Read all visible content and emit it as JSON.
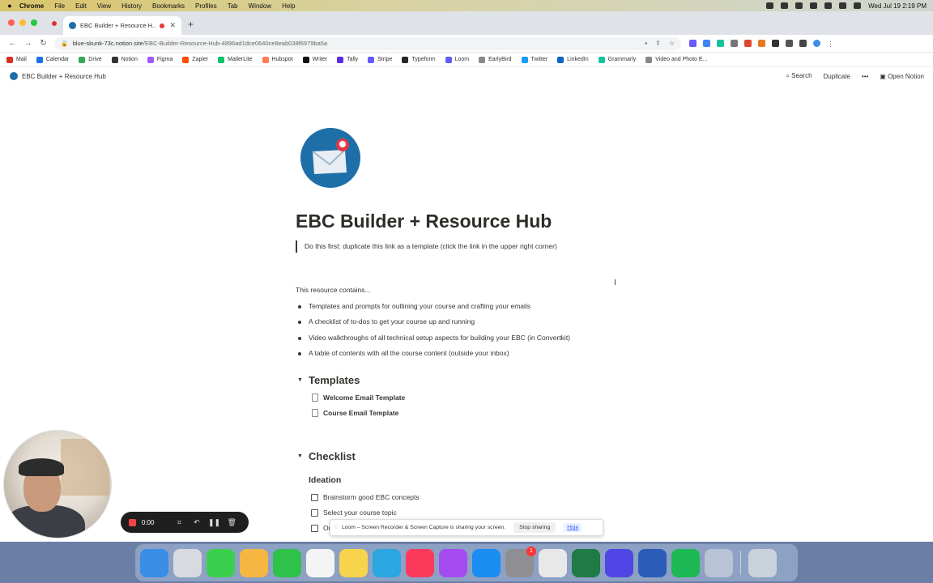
{
  "menubar": {
    "apple": "",
    "items": [
      "Chrome",
      "File",
      "Edit",
      "View",
      "History",
      "Bookmarks",
      "Profiles",
      "Tab",
      "Window",
      "Help"
    ],
    "datetime": "Wed Jul 19  2:19 PM"
  },
  "browser": {
    "tab_title": "EBC Builder + Resource H...",
    "url_host": "blue-skunk-73c.notion.site",
    "url_path": "/EBC-Builder-Resource-Hub-4896ad1dce0640ce8eab038f6979ba5a",
    "bookmarks": [
      {
        "label": "Mail",
        "color": "#d93025"
      },
      {
        "label": "Calendar",
        "color": "#1a73e8"
      },
      {
        "label": "Drive",
        "color": "#34a853"
      },
      {
        "label": "Notion",
        "color": "#333333"
      },
      {
        "label": "Figma",
        "color": "#a259ff"
      },
      {
        "label": "Zapier",
        "color": "#ff4a00"
      },
      {
        "label": "MailerLite",
        "color": "#09c269"
      },
      {
        "label": "Hubspot",
        "color": "#ff7a59"
      },
      {
        "label": "Writer",
        "color": "#111111"
      },
      {
        "label": "Tally",
        "color": "#5b2be0"
      },
      {
        "label": "Stripe",
        "color": "#635bff"
      },
      {
        "label": "Typeform",
        "color": "#262627"
      },
      {
        "label": "Loom",
        "color": "#625df5"
      },
      {
        "label": "EarlyBird",
        "color": "#888888"
      },
      {
        "label": "Twitter",
        "color": "#1d9bf0"
      },
      {
        "label": "LinkedIn",
        "color": "#0a66c2"
      },
      {
        "label": "Grammarly",
        "color": "#15c39a"
      },
      {
        "label": "Video and Photo E...",
        "color": "#888888"
      }
    ]
  },
  "notion": {
    "breadcrumb": "EBC Builder + Resource Hub",
    "search": "Search",
    "duplicate": "Duplicate",
    "more": "•••",
    "open_notion": "Open Notion",
    "title": "EBC Builder + Resource Hub",
    "quote": "Do this first: duplicate this link as a template (click the link in the upper right corner)",
    "intro": "This resource contains...",
    "bullets": [
      "Templates and prompts for outlining your course and crafting your emails",
      "A checklist of to-dos to get your course up and running",
      "Video walkthroughs of all technical setup aspects for building your EBC (in Convertkit)",
      "A table of contents with all the course content (outside your inbox)"
    ],
    "templates_heading": "Templates",
    "templates": [
      "Welcome Email Template",
      "Course Email Template"
    ],
    "checklist_heading": "Checklist",
    "ideation_heading": "Ideation",
    "todos": [
      "Brainstorm good EBC concepts",
      "Select your course topic",
      "Ou"
    ]
  },
  "loom": {
    "banner_text": "Loom – Screen Recorder & Screen Capture is sharing your screen.",
    "stop_sharing": "Stop sharing",
    "hide": "Hide",
    "timer": "0:00"
  },
  "dock": {
    "apps": [
      {
        "name": "finder",
        "color": "#3b8ee6"
      },
      {
        "name": "launchpad",
        "color": "#d9d9e0"
      },
      {
        "name": "messages",
        "color": "#3ccf4e"
      },
      {
        "name": "photos",
        "color": "#f5b642"
      },
      {
        "name": "facetime",
        "color": "#2fc24a"
      },
      {
        "name": "reminders",
        "color": "#f4f4f4"
      },
      {
        "name": "notes",
        "color": "#f7d44c"
      },
      {
        "name": "freeform",
        "color": "#2aa6e0"
      },
      {
        "name": "music",
        "color": "#fb3a5c"
      },
      {
        "name": "podcasts",
        "color": "#a44cf0"
      },
      {
        "name": "app-store",
        "color": "#1b8cf2"
      },
      {
        "name": "system-settings",
        "color": "#8e8e93"
      },
      {
        "name": "chrome",
        "color": "#e8e8e8"
      },
      {
        "name": "excel",
        "color": "#1f7a43"
      },
      {
        "name": "loom",
        "color": "#4f46e5"
      },
      {
        "name": "word",
        "color": "#2b5cb8"
      },
      {
        "name": "spotify",
        "color": "#1db954"
      },
      {
        "name": "preview",
        "color": "#b8c4d6"
      },
      {
        "name": "trash",
        "color": "#c9d1db"
      }
    ],
    "settings_badge": "1"
  }
}
